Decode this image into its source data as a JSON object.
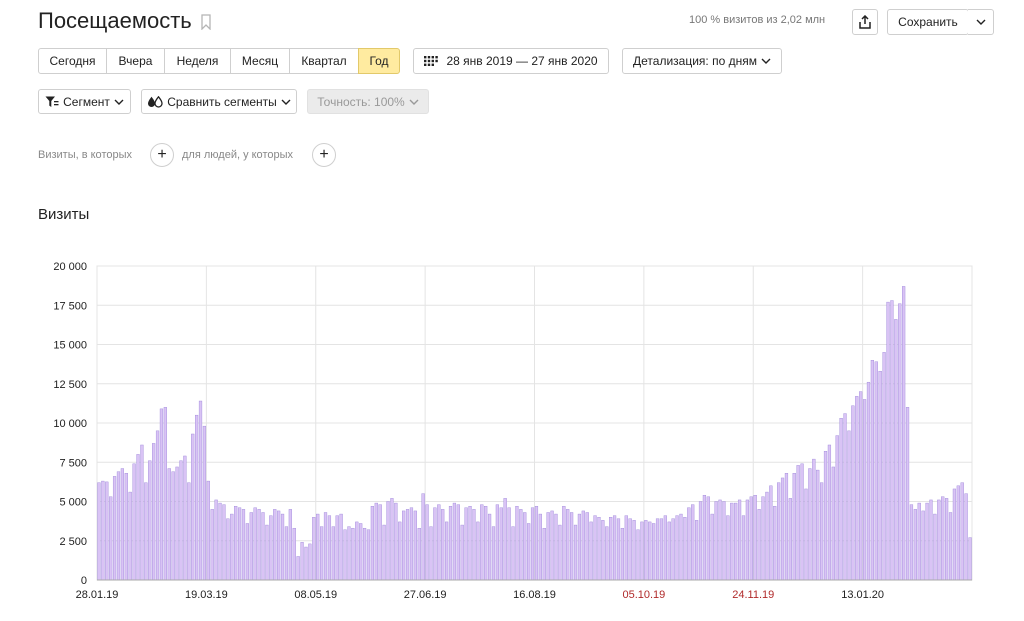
{
  "header": {
    "title": "Посещаемость",
    "visits_share": "100 % визитов из 2,02 млн",
    "save_label": "Сохранить"
  },
  "toolbar": {
    "periods": [
      {
        "label": "Сегодня",
        "active": false
      },
      {
        "label": "Вчера",
        "active": false
      },
      {
        "label": "Неделя",
        "active": false
      },
      {
        "label": "Месяц",
        "active": false
      },
      {
        "label": "Квартал",
        "active": false
      },
      {
        "label": "Год",
        "active": true
      }
    ],
    "date_range": "28 янв 2019 — 27 янв 2020",
    "detail": "Детализация: по дням"
  },
  "filters": {
    "segment": "Сегмент",
    "compare": "Сравнить сегменты",
    "accuracy": "Точность: 100%",
    "visits_where": "Визиты, в которых",
    "people_where": "для людей, у которых"
  },
  "chart": {
    "title": "Визиты"
  },
  "chart_data": {
    "type": "bar",
    "ylim": [
      0,
      20000
    ],
    "yticks": [
      "0",
      "2 500",
      "5 000",
      "7 500",
      "10 000",
      "12 500",
      "15 000",
      "17 500",
      "20 000"
    ],
    "xticks": [
      {
        "label": "28.01.19",
        "weekend": false
      },
      {
        "label": "19.03.19",
        "weekend": false
      },
      {
        "label": "08.05.19",
        "weekend": false
      },
      {
        "label": "27.06.19",
        "weekend": false
      },
      {
        "label": "16.08.19",
        "weekend": false
      },
      {
        "label": "05.10.19",
        "weekend": true
      },
      {
        "label": "24.11.19",
        "weekend": true
      },
      {
        "label": "13.01.20",
        "weekend": false
      }
    ],
    "grid": true,
    "colors": {
      "bar": "#d9c3f5",
      "bar_edge": "#9a84d8",
      "grid": "#e4e4e4",
      "axis": "#aaaaaa",
      "weekend_label": "#b02a2a"
    },
    "values": [
      6200,
      6300,
      6250,
      5300,
      6600,
      6900,
      7100,
      6800,
      5600,
      7400,
      8000,
      8600,
      6200,
      7600,
      8700,
      9500,
      10900,
      11000,
      7100,
      6900,
      7200,
      7600,
      7900,
      6200,
      9300,
      10500,
      11400,
      9800,
      6300,
      4500,
      5100,
      4900,
      4800,
      3900,
      4200,
      4700,
      4600,
      4500,
      3600,
      4300,
      4600,
      4500,
      4300,
      3500,
      4100,
      4500,
      4400,
      4200,
      3400,
      4500,
      3300,
      1500,
      2400,
      2100,
      2300,
      4000,
      4200,
      3400,
      4300,
      4100,
      3400,
      4100,
      4200,
      3200,
      3400,
      3300,
      3700,
      3600,
      3300,
      3200,
      4700,
      4900,
      4800,
      3500,
      5000,
      5200,
      4900,
      3700,
      4400,
      4500,
      4600,
      4400,
      3300,
      5500,
      4800,
      3400,
      4600,
      4800,
      4500,
      3700,
      4700,
      4900,
      4800,
      3500,
      4600,
      4700,
      4500,
      3700,
      4800,
      4700,
      4200,
      3400,
      4800,
      4600,
      5200,
      4600,
      3400,
      4700,
      4500,
      4300,
      3600,
      4600,
      4700,
      4200,
      3300,
      4300,
      4400,
      4200,
      3500,
      4700,
      4500,
      4300,
      3500,
      4200,
      4400,
      4300,
      3700,
      4100,
      4000,
      3800,
      3400,
      4000,
      4100,
      3900,
      3300,
      4100,
      3900,
      3800,
      3200,
      3700,
      3800,
      3700,
      3600,
      3900,
      3900,
      4100,
      3700,
      3900,
      4100,
      4200,
      4000,
      4600,
      4800,
      3800,
      5000,
      5400,
      5300,
      4200,
      5000,
      5100,
      5000,
      4100,
      4900,
      4900,
      5100,
      4100,
      5100,
      5300,
      5400,
      4500,
      5300,
      5600,
      6000,
      4700,
      6200,
      6500,
      6800,
      5200,
      6800,
      7300,
      7400,
      5800,
      7100,
      7700,
      7000,
      6200,
      8200,
      8600,
      7200,
      9200,
      10300,
      10600,
      9500,
      11100,
      11700,
      12000,
      11500,
      12600,
      14000,
      13900,
      13300,
      14500,
      17700,
      17800,
      16600,
      17600,
      18700,
      11000,
      4800,
      4500,
      4900,
      4400,
      4900,
      5100,
      4200,
      5100,
      5300,
      5200,
      4300,
      5800,
      6000,
      6200,
      5500,
      2700
    ]
  }
}
